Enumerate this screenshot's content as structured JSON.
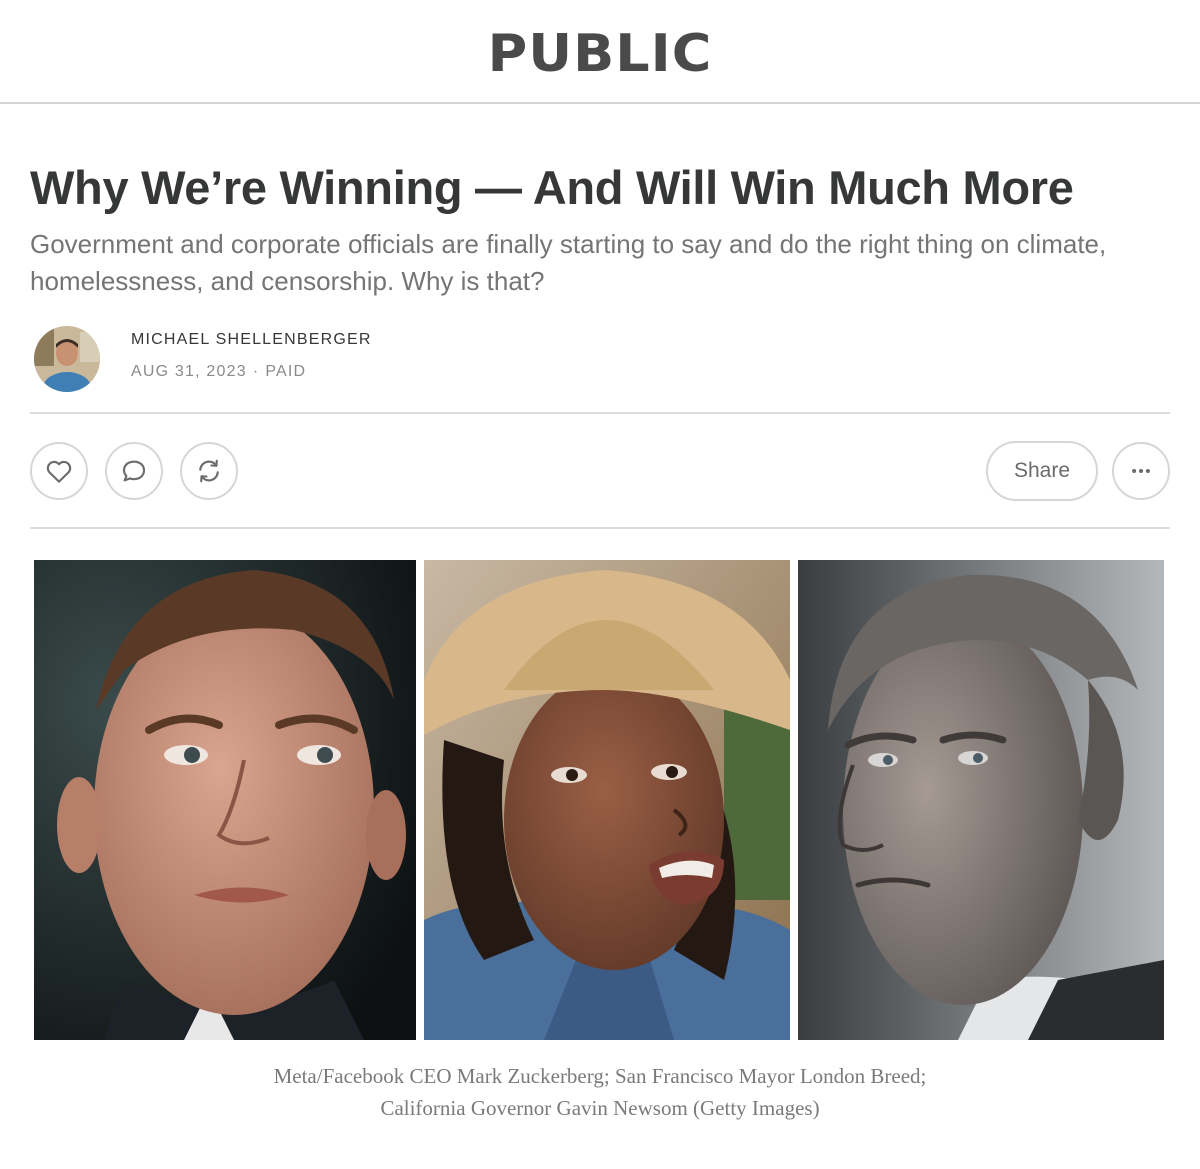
{
  "header": {
    "logo_text": "PUBLIC"
  },
  "article": {
    "title": "Why We’re Winning — And Will Win Much More",
    "subtitle": "Government and corporate officials are finally starting to say and do the right thing on climate, homelessness, and censorship. Why is that?",
    "author": "MICHAEL SHELLENBERGER",
    "date": "AUG 31, 2023",
    "separator": "·",
    "access": "PAID"
  },
  "actions": {
    "like_icon": "heart-icon",
    "comment_icon": "comment-icon",
    "restack_icon": "restack-icon",
    "share_label": "Share",
    "more_icon": "ellipsis-icon"
  },
  "figure": {
    "caption_line1": "Meta/Facebook CEO Mark Zuckerberg; San Francisco Mayor London Breed;",
    "caption_line2": "California Governor Gavin Newsom (Getty Images)"
  },
  "colors": {
    "text": "#363737",
    "muted": "#757575",
    "border": "#d6d6d6"
  }
}
